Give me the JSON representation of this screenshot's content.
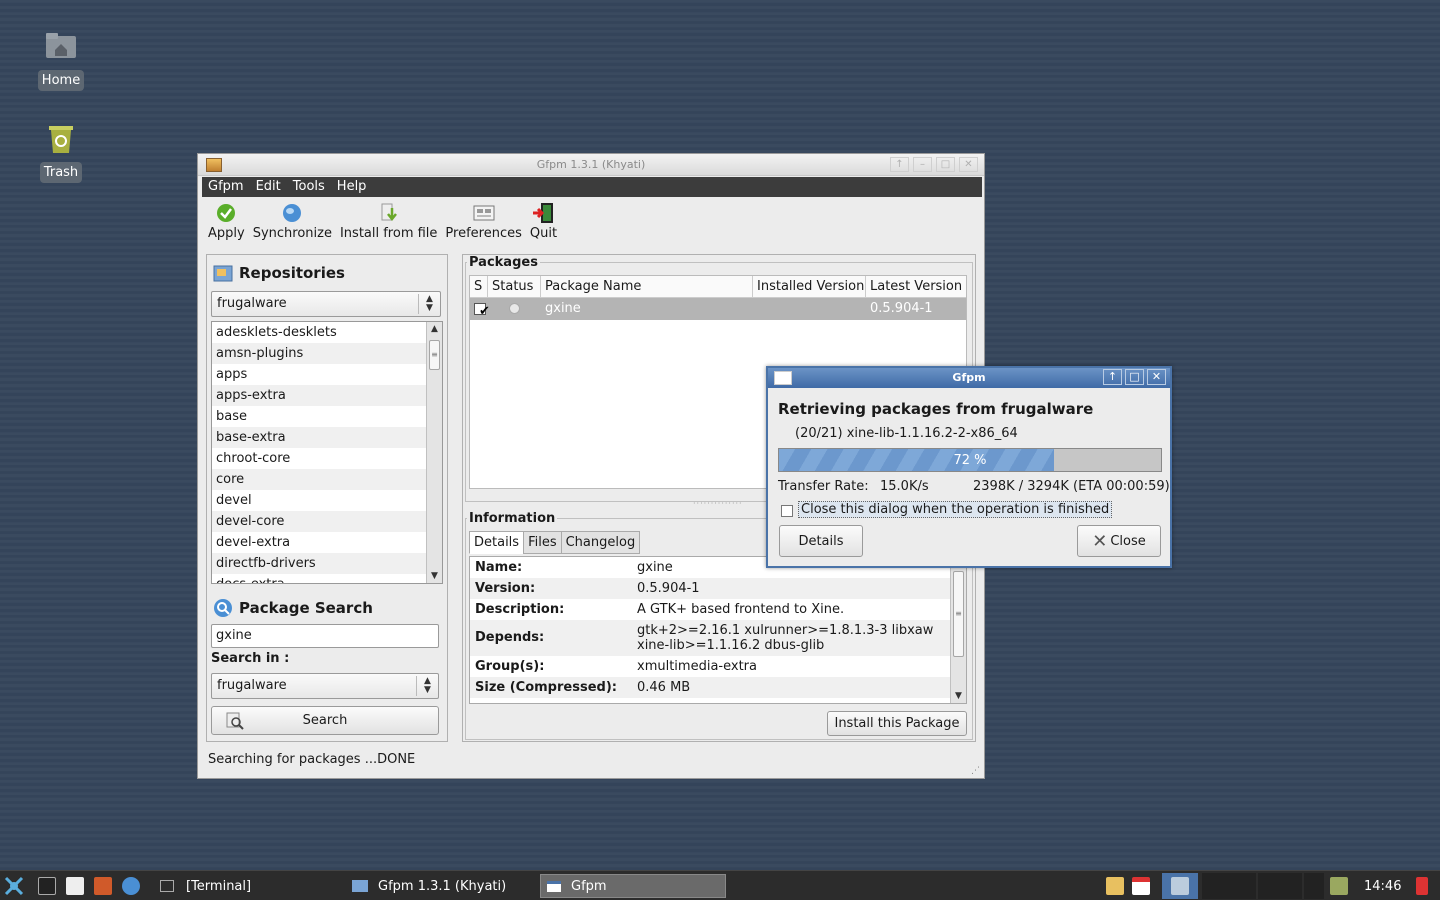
{
  "desktop": {
    "icons": [
      {
        "label": "Home"
      },
      {
        "label": "Trash"
      }
    ]
  },
  "window": {
    "title": "Gfpm 1.3.1 (Khyati)",
    "menu": [
      "Gfpm",
      "Edit",
      "Tools",
      "Help"
    ],
    "toolbar": [
      "Apply",
      "Synchronize",
      "Install from file",
      "Preferences",
      "Quit"
    ],
    "repositories": {
      "title": "Repositories",
      "selected": "frugalware",
      "items": [
        "adesklets-desklets",
        "amsn-plugins",
        "apps",
        "apps-extra",
        "base",
        "base-extra",
        "chroot-core",
        "core",
        "devel",
        "devel-core",
        "devel-extra",
        "directfb-drivers",
        "docs-extra"
      ]
    },
    "search": {
      "title": "Package Search",
      "value": "gxine",
      "search_in_label": "Search in :",
      "search_in": "frugalware",
      "button": "Search"
    },
    "packages": {
      "frame": "Packages",
      "columns": [
        "S",
        "Status",
        "Package Name",
        "Installed Version",
        "Latest Version"
      ],
      "rows": [
        {
          "name": "gxine",
          "installed": "",
          "latest": "0.5.904-1"
        }
      ]
    },
    "information": {
      "frame": "Information",
      "tabs": [
        "Details",
        "Files",
        "Changelog"
      ],
      "rows": [
        {
          "k": "Name:",
          "v": "gxine"
        },
        {
          "k": "Version:",
          "v": "0.5.904-1"
        },
        {
          "k": "Description:",
          "v": "A GTK+ based frontend to Xine."
        },
        {
          "k": "Depends:",
          "v": "gtk+2>=2.16.1 xulrunner>=1.8.1.3-3 libxaw",
          "v2": "xine-lib>=1.1.16.2 dbus-glib"
        },
        {
          "k": "Group(s):",
          "v": "xmultimedia-extra"
        },
        {
          "k": "Size (Compressed):",
          "v": "0.46 MB"
        }
      ],
      "install_button": "Install this Package"
    },
    "status": "Searching for packages ...DONE"
  },
  "dialog": {
    "title": "Gfpm",
    "heading": "Retrieving packages from frugalware",
    "file": "(20/21) xine-lib-1.1.16.2-2-x86_64",
    "progress_fraction": 0.72,
    "progress_label": "72 %",
    "rate_label": "Transfer Rate:",
    "rate": "15.0K/s",
    "size": "2398K / 3294K (ETA 00:00:59)",
    "close_when_done": "Close this dialog when the operation is finished",
    "details_button": "Details",
    "close_button": "Close"
  },
  "taskbar": {
    "tasks": [
      "[Terminal]",
      "Gfpm 1.3.1 (Khyati)",
      "Gfpm"
    ],
    "clock": "14:46"
  }
}
